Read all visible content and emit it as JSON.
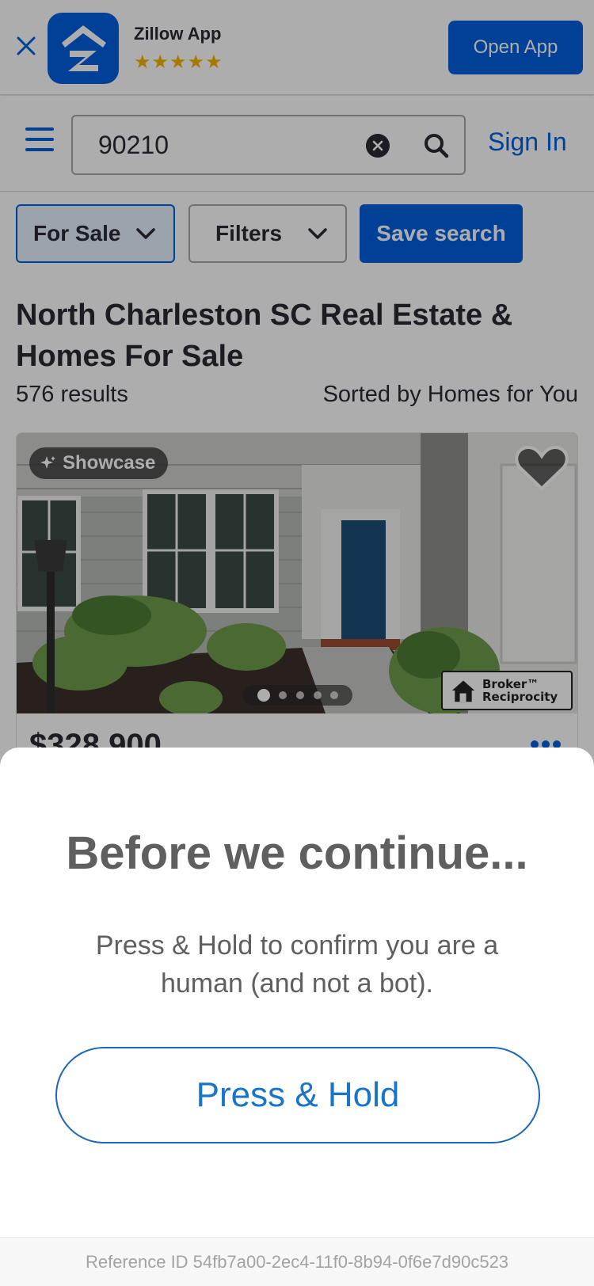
{
  "banner": {
    "app_name": "Zillow App",
    "rating_stars": "★★★★★",
    "open_label": "Open App"
  },
  "search": {
    "value": "90210",
    "sign_in": "Sign In"
  },
  "filters": {
    "for_sale": "For Sale",
    "filters": "Filters",
    "save_search": "Save search"
  },
  "results": {
    "title": "North Charleston SC Real Estate & Homes For Sale",
    "count": "576 results",
    "sort": "Sorted by Homes for You"
  },
  "listing": {
    "badge": "Showcase",
    "price": "$328,900",
    "broker_line1": "Broker™",
    "broker_line2": "Reciprocity",
    "photo_index": 1,
    "photo_total": 5
  },
  "modal": {
    "heading": "Before we continue...",
    "instructions": "Press & Hold to confirm you are a human (and not a bot).",
    "button": "Press & Hold",
    "reference": "Reference ID 54fb7a00-2ec4-11f0-8b94-0f6e7d90c523"
  },
  "colors": {
    "brand_blue": "#0061df",
    "button_blue": "#1a75c8",
    "star_gold": "#f5b400",
    "modal_text": "#5f5f5f"
  },
  "icons": [
    "close-icon",
    "zillow-logo",
    "hamburger-icon",
    "clear-icon",
    "search-icon",
    "chevron-down-icon",
    "sparkle-icon",
    "heart-icon",
    "more-icon",
    "broker-house-icon"
  ]
}
